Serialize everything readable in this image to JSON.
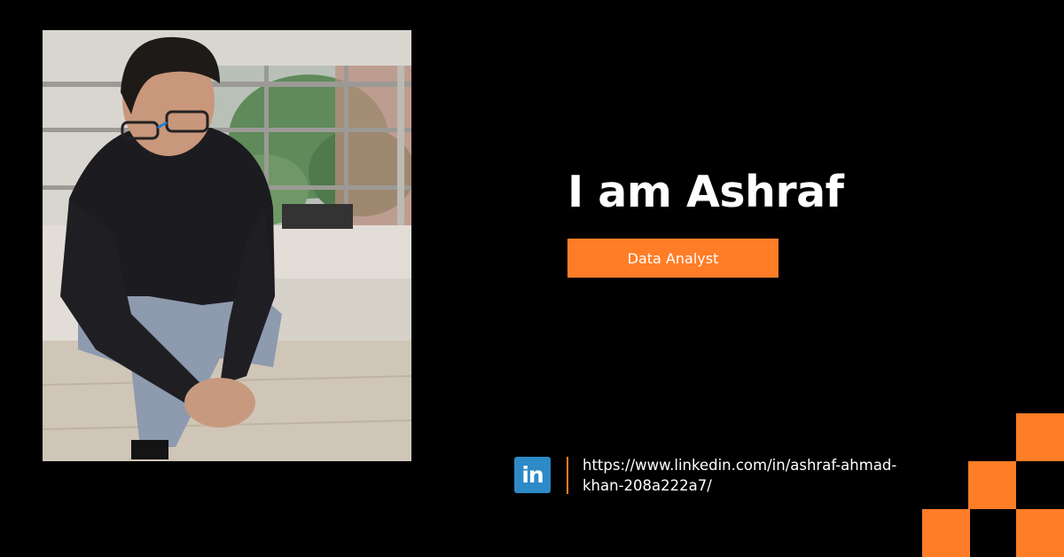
{
  "profile": {
    "headline": "I am Ashraf",
    "role": "Data Analyst",
    "photo_alt": "Portrait photo"
  },
  "contact": {
    "icon": "linkedin-icon",
    "icon_text": "in",
    "linkedin_url": "https://www.linkedin.com/in/ashraf-ahmad-khan-208a222a7/"
  },
  "colors": {
    "background": "#000000",
    "accent": "#ff7d26",
    "linkedin": "#2d8ac7",
    "text": "#ffffff"
  }
}
